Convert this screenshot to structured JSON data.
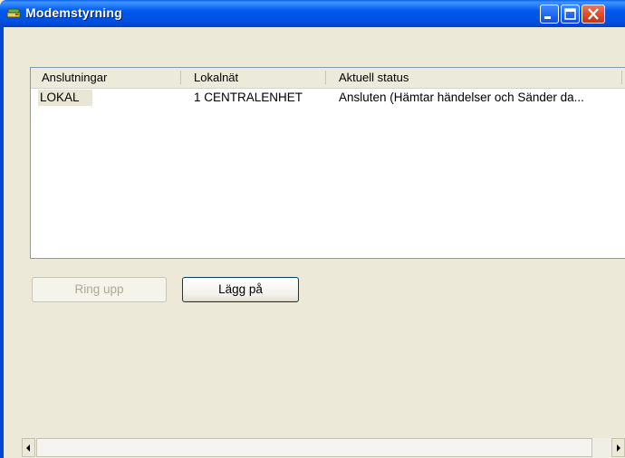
{
  "window": {
    "title": "Modemstyrning"
  },
  "listview": {
    "columns": [
      "Anslutningar",
      "Lokalnät",
      "Aktuell status"
    ],
    "rows": [
      {
        "connection": "LOKAL",
        "network": "1 CENTRALENHET",
        "status": "Ansluten (Hämtar händelser och Sänder da..."
      }
    ]
  },
  "buttons": {
    "dial": "Ring upp",
    "hangup": "Lägg på"
  },
  "icons": {
    "app": "modem-icon",
    "minimize": "minimize-icon",
    "maximize": "maximize-icon",
    "close": "close-icon"
  }
}
